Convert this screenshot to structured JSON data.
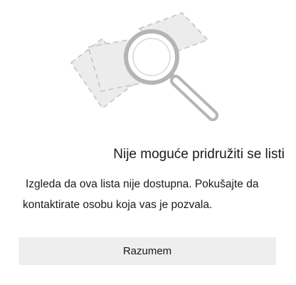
{
  "dialog": {
    "title": "Nije moguće pridružiti se listi",
    "message_line1": "Izgleda da ova lista nije dostupna. Pokušajte da",
    "message_line2": "kontaktirate osobu koja vas je pozvala.",
    "button_label": "Razumem"
  },
  "illustration": {
    "icon": "magnifying-glass-over-dashed-shapes-icon",
    "fill_color": "#ececec",
    "stroke_color": "#c4c4c4",
    "lens_color": "#b5b5b5"
  }
}
